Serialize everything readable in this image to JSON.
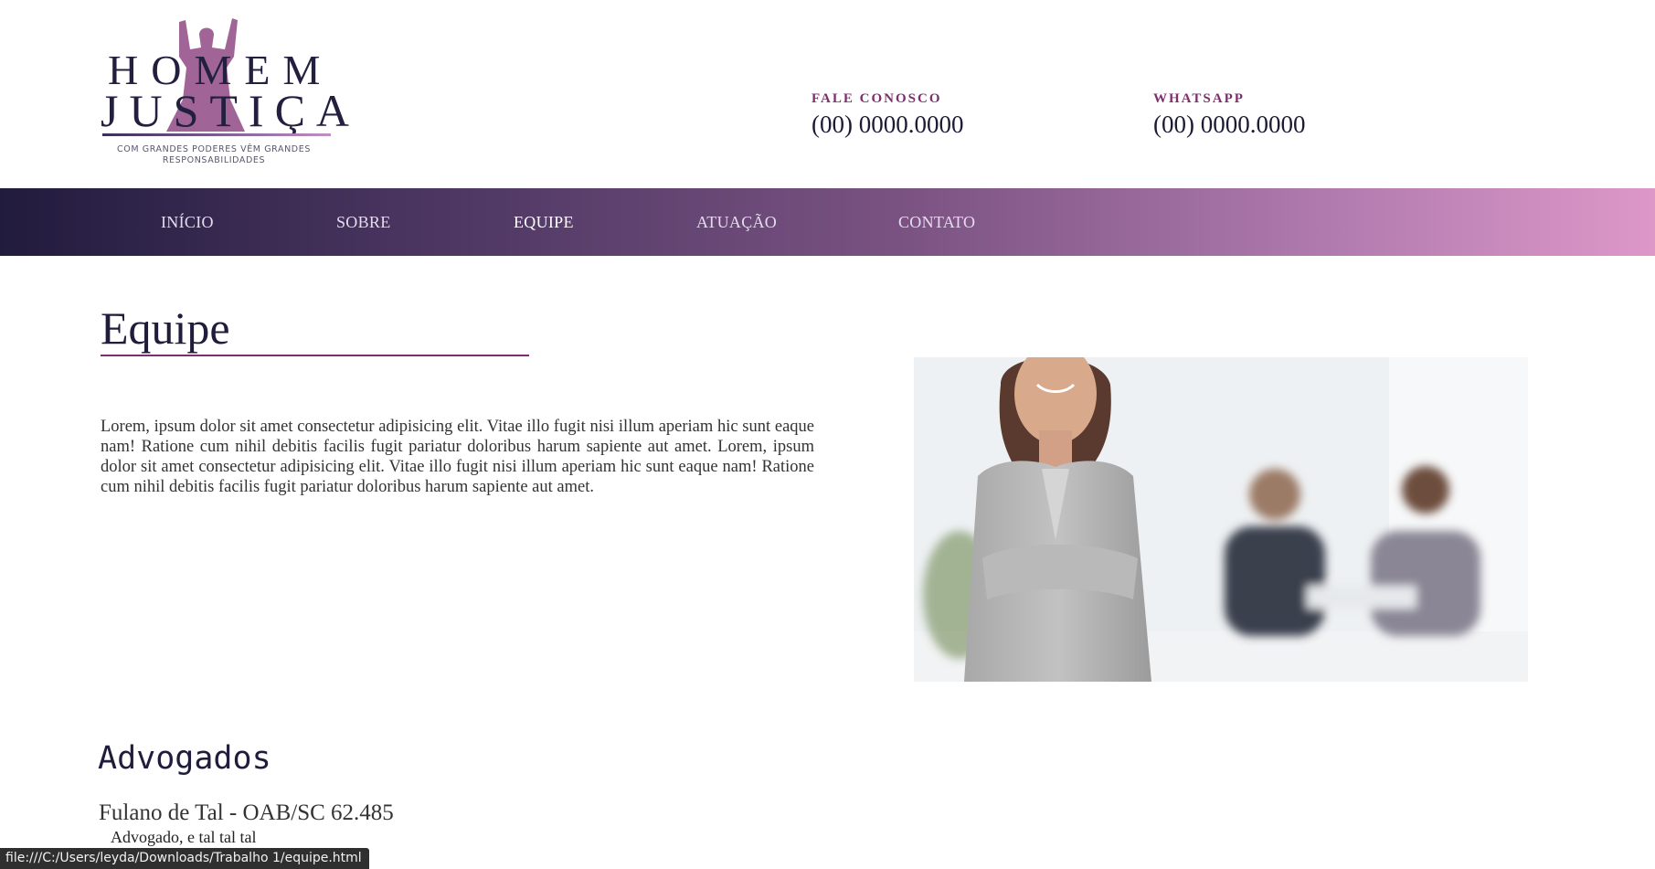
{
  "header": {
    "logo": {
      "line1": "HOMEM",
      "line2": "JUSTIÇA",
      "tagline": "COM GRANDES PODERES VÊM GRANDES RESPONSABILIDADES"
    },
    "contacts": [
      {
        "label": "FALE CONOSCO",
        "value": "(00) 0000.0000"
      },
      {
        "label": "WHATSAPP",
        "value": "(00) 0000.0000"
      }
    ]
  },
  "nav": {
    "items": [
      {
        "label": "INÍCIO"
      },
      {
        "label": "SOBRE"
      },
      {
        "label": "EQUIPE",
        "active": true
      },
      {
        "label": "ATUAÇÃO"
      },
      {
        "label": "CONTATO"
      }
    ]
  },
  "main": {
    "title": "Equipe",
    "intro": "Lorem, ipsum dolor sit amet consectetur adipisicing elit. Vitae illo fugit nisi illum aperiam hic sunt eaque nam! Ratione cum nihil debitis facilis fugit pariatur doloribus harum sapiente aut amet. Lorem, ipsum dolor sit amet consectetur adipisicing elit. Vitae illo fugit nisi illum aperiam hic sunt eaque nam! Ratione cum nihil debitis facilis fugit pariatur doloribus harum sapiente aut amet."
  },
  "advogados": {
    "heading": "Advogados",
    "items": [
      {
        "name": "Fulano de Tal - OAB/SC 62.485",
        "description": "Advogado, e tal tal tal"
      }
    ]
  },
  "statusbar": {
    "url": "file:///C:/Users/leyda/Downloads/Trabalho 1/equipe.html"
  },
  "colors": {
    "brand_dark": "#1f1d3b",
    "accent": "#7d2e6c",
    "nav_gradient_start": "#211b3d",
    "nav_gradient_end": "#dd98c8"
  }
}
